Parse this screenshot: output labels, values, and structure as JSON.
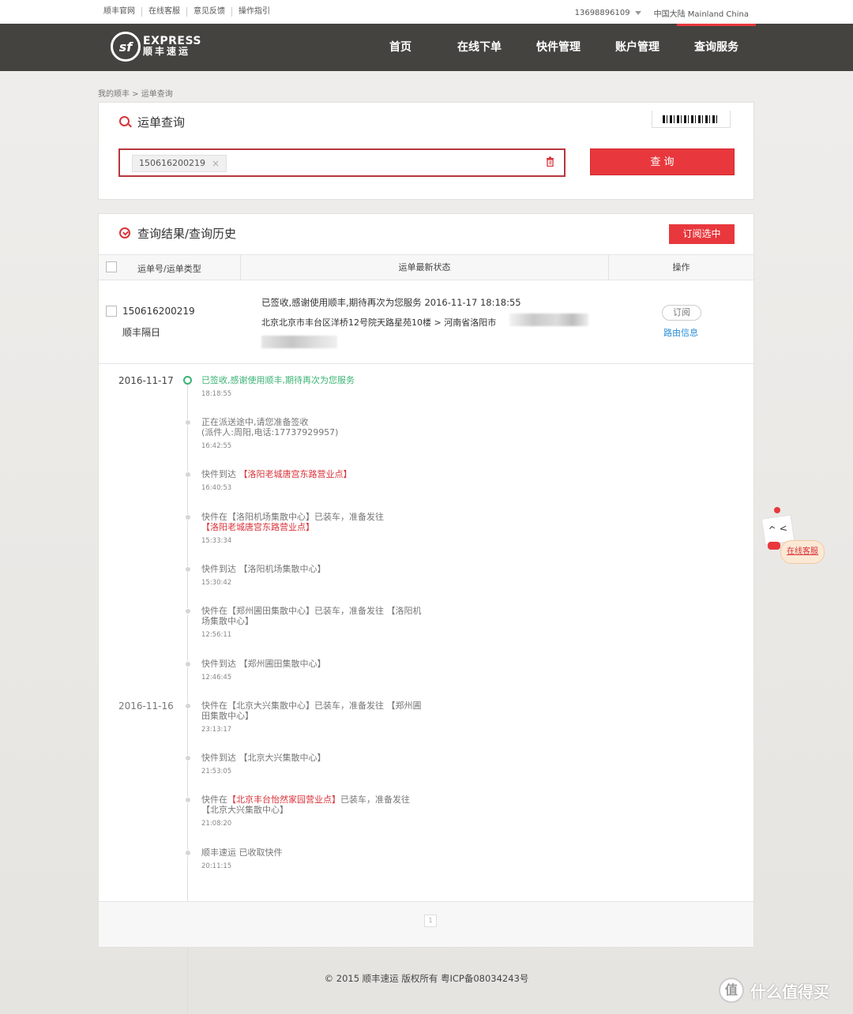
{
  "topbar": {
    "links": [
      "顺丰官网",
      "在线客服",
      "意见反馈",
      "操作指引"
    ],
    "phone": "13698896109",
    "region": "中国大陆 Mainland China"
  },
  "nav": {
    "logo_mark": "sf",
    "logo_en": "EXPRESS",
    "logo_cn": "顺丰速运",
    "items": [
      "首页",
      "在线下单",
      "快件管理",
      "账户管理",
      "查询服务"
    ],
    "accent": "#e8383d"
  },
  "breadcrumb": "我的顺丰 > 运单查询",
  "query_panel": {
    "title": "运单查询",
    "tag_value": "150616200219",
    "tag_close": "×",
    "search_button": "查 询"
  },
  "results_panel": {
    "title": "查询结果/查询历史",
    "subscribe_selected": "订阅选中",
    "columns": [
      "运单号/运单类型",
      "运单最新状态",
      "操作"
    ],
    "row": {
      "waybill": "150616200219",
      "type": "顺丰隔日",
      "status": "已签收,感谢使用顺丰,期待再次为您服务 2016-11-17 18:18:55",
      "route": "北京北京市丰台区洋桥12号院天路星苑10楼 > 河南省洛阳市",
      "subscribe": "订阅",
      "route_info": "路由信息"
    }
  },
  "timeline": {
    "dates": [
      "2016-11-17",
      "2016-11-16"
    ],
    "events": [
      {
        "pre": "已签收,感谢使用顺丰,期待再次为您服务",
        "hl": "",
        "post": "",
        "line2": "",
        "line2_hl": "",
        "time": "18:18:55"
      },
      {
        "pre": "正在派送途中,请您准备签收",
        "hl": "",
        "post": "",
        "line2": "(派件人:周阳,电话:17737929957)",
        "line2_hl": "",
        "time": "16:42:55"
      },
      {
        "pre": "快件到达 ",
        "hl": "【洛阳老城唐宫东路营业点】",
        "post": "",
        "line2": "",
        "line2_hl": "",
        "time": "16:40:53"
      },
      {
        "pre": "快件在【洛阳机场集散中心】已装车，准备发往",
        "hl": "",
        "post": "",
        "line2": "",
        "line2_hl": "【洛阳老城唐宫东路营业点】",
        "time": "15:33:34"
      },
      {
        "pre": "快件到达 【洛阳机场集散中心】",
        "hl": "",
        "post": "",
        "line2": "",
        "line2_hl": "",
        "time": "15:30:42"
      },
      {
        "pre": "快件在【郑州圃田集散中心】已装车，准备发往 【洛阳机",
        "hl": "",
        "post": "",
        "line2": "场集散中心】",
        "line2_hl": "",
        "time": "12:56:11"
      },
      {
        "pre": "快件到达 【郑州圃田集散中心】",
        "hl": "",
        "post": "",
        "line2": "",
        "line2_hl": "",
        "time": "12:46:45"
      },
      {
        "pre": "快件在【北京大兴集散中心】已装车，准备发往 【郑州圃",
        "hl": "",
        "post": "",
        "line2": "田集散中心】",
        "line2_hl": "",
        "time": "23:13:17"
      },
      {
        "pre": "快件到达 【北京大兴集散中心】",
        "hl": "",
        "post": "",
        "line2": "",
        "line2_hl": "",
        "time": "21:53:05"
      },
      {
        "pre": "快件在",
        "hl": "【北京丰台怡然家园营业点】",
        "post": "已装车，准备发往",
        "line2": "【北京大兴集散中心】",
        "line2_hl": "",
        "time": "21:08:20"
      },
      {
        "pre": "顺丰速运 已收取快件",
        "hl": "",
        "post": "",
        "line2": "",
        "line2_hl": "",
        "time": "20:11:15"
      }
    ]
  },
  "pager": {
    "page": "1"
  },
  "footer": "© 2015 顺丰速运 版权所有 粤ICP备08034243号",
  "service_widget": {
    "label": "在线客服",
    "face": "^ <"
  },
  "watermark": {
    "mark": "值",
    "text": "什么值得买"
  }
}
